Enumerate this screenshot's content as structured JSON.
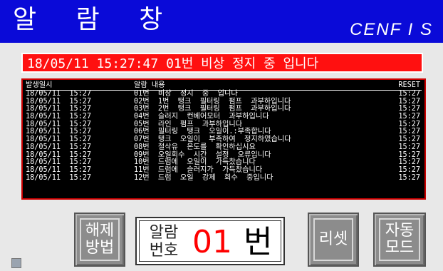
{
  "header": {
    "title": "알 람 창",
    "brand": "CENF I S"
  },
  "banner": {
    "text": "18/05/11  15:27:47  01번  비상  정지  중  입니다"
  },
  "table": {
    "headers": {
      "time": "발생일시",
      "msg": "알람 내용",
      "reset": "RESET"
    },
    "rows": [
      {
        "time": "18/05/11  15:27",
        "msg": "01번  비상  정지  중  입니다",
        "reset": "15:27"
      },
      {
        "time": "18/05/11  15:27",
        "msg": "02번  1번  탱크  필터링  펌프  과부하입니다",
        "reset": "15:27"
      },
      {
        "time": "18/05/11  15:27",
        "msg": "03번  2번  탱크  필터링  펌프  과부하입니다",
        "reset": "15:27"
      },
      {
        "time": "18/05/11  15:27",
        "msg": "04번  슬러지  컨베어모터  과부하입니다",
        "reset": "15:27"
      },
      {
        "time": "18/05/11  15:27",
        "msg": "05번  라인  펌프  과부하입니다",
        "reset": "15:27"
      },
      {
        "time": "18/05/11  15:27",
        "msg": "06번  필터링  탱크  오일이.:부족합니다",
        "reset": "15:27"
      },
      {
        "time": "18/05/11  15:27",
        "msg": "07번  탱크  오일이  부족하여  정지하였습니다",
        "reset": "15:27"
      },
      {
        "time": "18/05/11  15:27",
        "msg": "08번  절삭유  온도를  확인하십시요",
        "reset": "15:27"
      },
      {
        "time": "18/05/11  15:27",
        "msg": "09번  오일회수  시간  설정  오류입니다",
        "reset": "15:27"
      },
      {
        "time": "18/05/11  15:27",
        "msg": "10번  드럼에  오일이  가득찼습니다",
        "reset": "15:27"
      },
      {
        "time": "18/05/11  15:27",
        "msg": "11번  드럼에  슬러지가  가득찼습니다",
        "reset": "15:27"
      },
      {
        "time": "18/05/11  15:27",
        "msg": "12번  드럼  오일  강제  회수  중입니다",
        "reset": "15:27"
      }
    ]
  },
  "buttons": {
    "release": {
      "line1": "해제",
      "line2": "방법"
    },
    "reset": {
      "label": "리셋"
    },
    "auto": {
      "line1": "자동",
      "line2": "모드"
    }
  },
  "alarm_display": {
    "label_line1": "알람",
    "label_line2": "번호",
    "number": "01",
    "unit": "번"
  },
  "colors": {
    "title_bg": "#0a0ad8",
    "banner_bg": "#ff1010",
    "number_color": "#ff0000"
  }
}
